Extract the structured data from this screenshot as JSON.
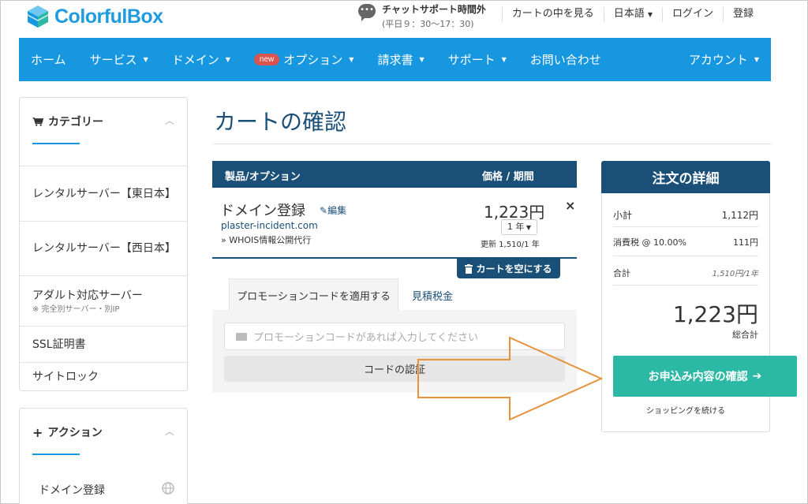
{
  "brand": {
    "name": "ColorfulBox",
    "accent": "#1797e0",
    "navy": "#1a4f78",
    "teal": "#2bb8a4"
  },
  "chat": {
    "title": "チャットサポート時間外",
    "hours": "(平日９：30～17：30)"
  },
  "toplinks": {
    "cart": "カートの中を見る",
    "language": "日本語",
    "login": "ログイン",
    "register": "登録"
  },
  "nav": {
    "home": "ホーム",
    "service": "サービス",
    "domain": "ドメイン",
    "new_badge": "new",
    "option": "オプション",
    "invoice": "請求書",
    "support": "サポート",
    "contact": "お問い合わせ",
    "account": "アカウント"
  },
  "sidebar": {
    "category_title": "カテゴリー",
    "items": [
      {
        "label": "レンタルサーバー【東日本】",
        "sub": ""
      },
      {
        "label": "レンタルサーバー【西日本】",
        "sub": ""
      },
      {
        "label": "アダルト対応サーバー",
        "sub": "※ 完全別サーバー・別IP"
      },
      {
        "label": "SSL証明書",
        "sub": ""
      },
      {
        "label": "サイトロック",
        "sub": ""
      }
    ],
    "action_title": "アクション",
    "action_items": [
      {
        "label": "ドメイン登録"
      }
    ]
  },
  "main": {
    "page_title": "カートの確認",
    "cart_header": {
      "product": "製品/オプション",
      "price": "価格 / 期間"
    },
    "item": {
      "name": "ドメイン登録",
      "edit": "編集",
      "domain": "plaster-incident.com",
      "option": "» WHOIS情報公開代行",
      "price": "1,223円",
      "term": "1 年",
      "renew": "更新 1,510/1 年"
    },
    "empty_cart": "カートを空にする",
    "tabs": {
      "promo": "プロモーションコードを適用する",
      "estimate": "見積税金"
    },
    "promo": {
      "placeholder": "プロモーションコードがあれば入力してください",
      "verify": "コードの認証"
    }
  },
  "summary": {
    "title": "注文の詳細",
    "subtotal_label": "小計",
    "subtotal": "1,112円",
    "tax_label": "消費税 @ 10.00%",
    "tax": "111円",
    "total_label_row": "合計",
    "total_term": "1,510円/1年",
    "total": "1,223円",
    "total_label": "総合計",
    "checkout": "お申込み内容の確認",
    "continue": "ショッピングを続ける"
  }
}
